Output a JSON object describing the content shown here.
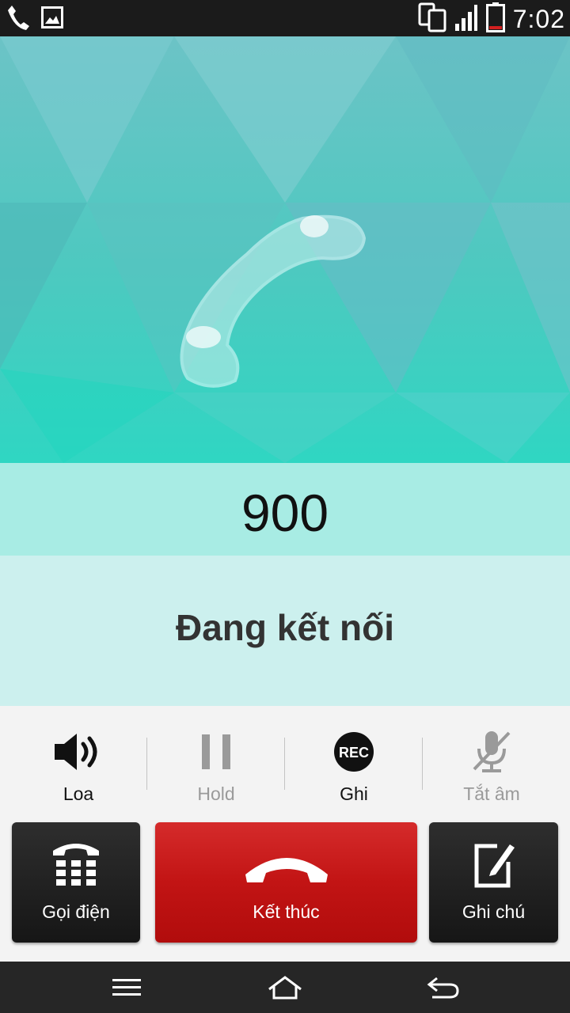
{
  "status_bar": {
    "time": "7:02",
    "icons": [
      "phone-icon",
      "image-icon",
      "dual-screen-icon",
      "signal-icon",
      "battery-icon"
    ]
  },
  "call": {
    "number": "900",
    "status": "Đang kết nối"
  },
  "options": [
    {
      "id": "speaker",
      "label": "Loa",
      "icon": "speaker-icon",
      "enabled": true
    },
    {
      "id": "hold",
      "label": "Hold",
      "icon": "pause-icon",
      "enabled": false
    },
    {
      "id": "record",
      "label": "Ghi",
      "icon": "rec-icon",
      "icon_text": "REC",
      "enabled": true
    },
    {
      "id": "mute",
      "label": "Tắt âm",
      "icon": "mic-off-icon",
      "enabled": false
    }
  ],
  "actions": {
    "dialpad_label": "Gọi điện",
    "end_label": "Kết thúc",
    "memo_label": "Ghi chú"
  },
  "nav": {
    "icons": [
      "menu-icon",
      "home-icon",
      "back-icon"
    ]
  },
  "colors": {
    "end_call": "#c21414",
    "action_dark": "#1f1f1f",
    "number_band": "#a8ece4",
    "status_band": "#ccf0ee"
  }
}
